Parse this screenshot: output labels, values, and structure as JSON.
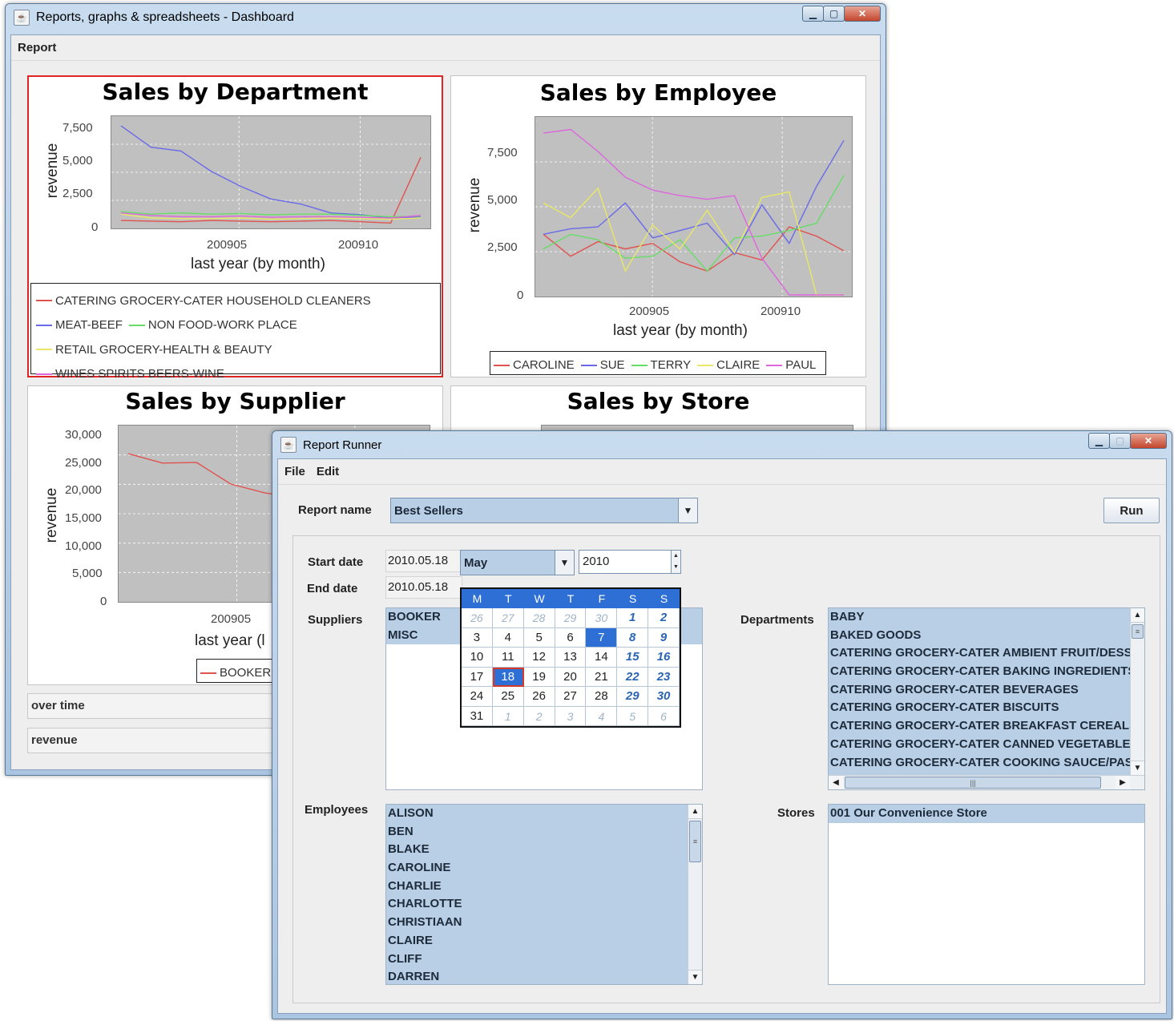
{
  "dashboard": {
    "title": "Reports, graphs & spreadsheets - Dashboard",
    "menu": [
      "Report"
    ],
    "charts": [
      {
        "title": "Sales by Department",
        "ylabel": "revenue",
        "xlabel": "last year (by month)",
        "yticks": [
          "7,500",
          "5,000",
          "2,500",
          "0"
        ],
        "xticks": [
          "200905",
          "200910"
        ],
        "legend": [
          "CATERING GROCERY-CATER HOUSEHOLD CLEANERS",
          "MEAT-BEEF",
          "NON FOOD-WORK PLACE",
          "RETAIL GROCERY-HEALTH & BEAUTY",
          "WINES SPIRITS BEERS-WINE"
        ]
      },
      {
        "title": "Sales by Employee",
        "ylabel": "revenue",
        "xlabel": "last year (by month)",
        "yticks": [
          "7,500",
          "5,000",
          "2,500",
          "0"
        ],
        "xticks": [
          "200905",
          "200910"
        ],
        "legend": [
          "CAROLINE",
          "SUE",
          "TERRY",
          "CLAIRE",
          "PAUL"
        ]
      },
      {
        "title": "Sales by Supplier",
        "ylabel": "revenue",
        "xlabel": "last year (l",
        "yticks": [
          "30,000",
          "25,000",
          "20,000",
          "15,000",
          "10,000",
          "5,000",
          "0"
        ],
        "xticks": [
          "200905"
        ],
        "legend": [
          "BOOKER"
        ]
      },
      {
        "title": "Sales by Store"
      }
    ],
    "fields": {
      "over_time": "over time",
      "revenue": "revenue"
    }
  },
  "chart_data": [
    {
      "type": "line",
      "title": "Sales by Department",
      "xlabel": "last year (by month)",
      "ylabel": "revenue",
      "x": [
        "200902",
        "200903",
        "200904",
        "200905",
        "200906",
        "200907",
        "200908",
        "200909",
        "200910",
        "200911",
        "200912"
      ],
      "ylim": [
        0,
        8500
      ],
      "series": [
        {
          "name": "CATERING GROCERY-CATER HOUSEHOLD CLEANERS",
          "color": "#e0524f",
          "values": [
            500,
            450,
            400,
            500,
            450,
            400,
            450,
            500,
            400,
            300,
            5500
          ]
        },
        {
          "name": "MEAT-BEEF",
          "color": "#6a6ae8",
          "values": [
            8000,
            6300,
            6000,
            4400,
            3200,
            2200,
            1800,
            1100,
            950,
            700,
            800
          ]
        },
        {
          "name": "NON FOOD-WORK PLACE",
          "color": "#66dd66",
          "values": [
            1200,
            1000,
            1100,
            1000,
            1050,
            950,
            1000,
            1000,
            900,
            800,
            850
          ]
        },
        {
          "name": "RETAIL GROCERY-HEALTH & BEAUTY",
          "color": "#e8e866",
          "values": [
            1000,
            700,
            650,
            650,
            700,
            600,
            650,
            700,
            650,
            600,
            700
          ]
        },
        {
          "name": "WINES SPIRITS BEERS-WINE",
          "color": "#dd66dd",
          "values": [
            1100,
            900,
            800,
            800,
            850,
            750,
            800,
            800,
            750,
            700,
            900
          ]
        }
      ]
    },
    {
      "type": "line",
      "title": "Sales by Employee",
      "xlabel": "last year (by month)",
      "ylabel": "revenue",
      "x": [
        "200902",
        "200903",
        "200904",
        "200905",
        "200906",
        "200907",
        "200908",
        "200909",
        "200910",
        "200911",
        "200912"
      ],
      "ylim": [
        0,
        9500
      ],
      "series": [
        {
          "name": "CAROLINE",
          "color": "#e0524f",
          "values": [
            3300,
            2100,
            2900,
            2500,
            2800,
            1800,
            1300,
            2300,
            1900,
            3700,
            3200,
            2400
          ]
        },
        {
          "name": "SUE",
          "color": "#6a6ae8",
          "values": [
            3300,
            3600,
            3700,
            5000,
            3100,
            3500,
            3900,
            2200,
            4900,
            2800,
            5900,
            8400
          ]
        },
        {
          "name": "TERRY",
          "color": "#66dd66",
          "values": [
            2500,
            3300,
            3000,
            2000,
            2100,
            3000,
            1300,
            3100,
            3200,
            3500,
            3900,
            6500
          ]
        },
        {
          "name": "CLAIRE",
          "color": "#e8e866",
          "values": [
            5000,
            4200,
            5800,
            1300,
            3800,
            2500,
            4600,
            2300,
            5300,
            5600,
            0,
            0
          ]
        },
        {
          "name": "PAUL",
          "color": "#dd66dd",
          "values": [
            8800,
            9000,
            7800,
            6400,
            5700,
            5400,
            5200,
            5400,
            2000,
            0,
            0,
            0
          ]
        }
      ]
    },
    {
      "type": "line",
      "title": "Sales by Supplier",
      "xlabel": "last year (l",
      "ylabel": "revenue",
      "x": [
        "200902",
        "200903",
        "200904",
        "200905",
        "200906"
      ],
      "ylim": [
        0,
        31000
      ],
      "series": [
        {
          "name": "BOOKER",
          "color": "#e0524f",
          "values": [
            26500,
            24800,
            24900,
            21000,
            19400,
            18500
          ]
        }
      ]
    }
  ],
  "runner": {
    "title": "Report Runner",
    "menu": [
      "File",
      "Edit"
    ],
    "report_name_label": "Report name",
    "report_name_value": "Best Sellers",
    "run_label": "Run",
    "start_date_label": "Start date",
    "start_date_value": "2010.05.18",
    "end_date_label": "End date",
    "end_date_value": "2010.05.18",
    "suppliers_label": "Suppliers",
    "suppliers": [
      "BOOKER",
      "MISC"
    ],
    "departments_label": "Departments",
    "departments": [
      "BABY",
      "BAKED GOODS",
      "CATERING GROCERY-CATER AMBIENT FRUIT/DESSERT",
      "CATERING GROCERY-CATER BAKING INGREDIENTS",
      "CATERING GROCERY-CATER BEVERAGES",
      "CATERING GROCERY-CATER BISCUITS",
      "CATERING GROCERY-CATER BREAKFAST CEREALS",
      "CATERING GROCERY-CATER CANNED VEGETABLES",
      "CATERING GROCERY-CATER COOKING SAUCE/PASTE"
    ],
    "employees_label": "Employees",
    "employees": [
      "ALISON",
      "BEN",
      "BLAKE",
      "CAROLINE",
      "CHARLIE",
      "CHARLOTTE",
      "CHRISTIAAN",
      "CLAIRE",
      "CLIFF",
      "DARREN"
    ],
    "stores_label": "Stores",
    "stores": [
      "001 Our Convenience Store"
    ],
    "calendar": {
      "month": "May",
      "year": "2010",
      "weekdays": [
        "M",
        "T",
        "W",
        "T",
        "F",
        "S",
        "S"
      ],
      "weeks": [
        [
          "26",
          "27",
          "28",
          "29",
          "30",
          "1",
          "2"
        ],
        [
          "3",
          "4",
          "5",
          "6",
          "7",
          "8",
          "9"
        ],
        [
          "10",
          "11",
          "12",
          "13",
          "14",
          "15",
          "16"
        ],
        [
          "17",
          "18",
          "19",
          "20",
          "21",
          "22",
          "23"
        ],
        [
          "24",
          "25",
          "26",
          "27",
          "28",
          "29",
          "30"
        ],
        [
          "31",
          "1",
          "2",
          "3",
          "4",
          "5",
          "6"
        ]
      ]
    }
  }
}
